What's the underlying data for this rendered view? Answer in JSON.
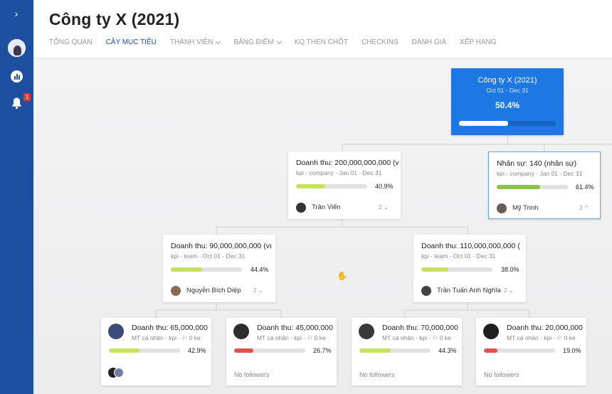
{
  "app": {
    "title": "Công ty X (2021)",
    "notification_count": "1",
    "accent_color": "#1e50a2",
    "root_color": "#1e78e3"
  },
  "sidebar": {
    "icons": [
      "expand-chevron-icon",
      "user-avatar",
      "chart-icon",
      "bell-icon"
    ]
  },
  "tabs": [
    {
      "label": "TỔNG QUAN",
      "active": false,
      "dropdown": false
    },
    {
      "label": "CÂY MỤC TIÊU",
      "active": true,
      "dropdown": false
    },
    {
      "label": "THÀNH VIÊN",
      "active": false,
      "dropdown": true
    },
    {
      "label": "BẢNG ĐIỂM",
      "active": false,
      "dropdown": true
    },
    {
      "label": "KQ THEN CHỐT",
      "active": false,
      "dropdown": false
    },
    {
      "label": "CHECKINS",
      "active": false,
      "dropdown": false
    },
    {
      "label": "ĐÁNH GIÁ",
      "active": false,
      "dropdown": false
    },
    {
      "label": "XẾP HẠNG",
      "active": false,
      "dropdown": false
    }
  ],
  "tree": {
    "root": {
      "title": "Công ty X (2021)",
      "date": "Oct 01 - Dec 31",
      "progress_label": "50.4%",
      "progress": 0.504
    },
    "level1": [
      {
        "title": "Doanh thu: 200,000,000,000 (v",
        "meta": "kpi · company · Jan 01 - Dec 31",
        "progress_label": "40.9%",
        "progress": 0.409,
        "bar_color": "#c5e25a",
        "owner": "Trần Viển",
        "count": "2"
      },
      {
        "title": "Nhân sự: 140 (nhân sự)",
        "meta": "kpi · company · Jan 01 - Dec 31",
        "progress_label": "61.4%",
        "progress": 0.614,
        "bar_color": "#8bc34a",
        "owner": "Mỹ Trinh",
        "count": "2"
      }
    ],
    "level2": [
      {
        "title": "Doanh thu: 90,000,000,000 (vı",
        "meta": "kpi · team · Oct 01 - Dec 31",
        "progress_label": "44.4%",
        "progress": 0.444,
        "bar_color": "#c5e25a",
        "owner": "Nguyễn Bích Diệp",
        "count": "2"
      },
      {
        "title": "Doanh thu: 110,000,000,000 (",
        "meta": "kpi · team · Oct 01 - Dec 31",
        "progress_label": "38.0%",
        "progress": 0.38,
        "bar_color": "#c5e25a",
        "owner": "Trần Tuấn Anh Nghĩa",
        "count": "2"
      }
    ],
    "level3": [
      {
        "title": "Doanh thu: 65,000,000",
        "meta": "MT cá nhân · kpi · ⚐ 0 ke",
        "progress_label": "42.9%",
        "progress": 0.429,
        "bar_color": "#c5e25a",
        "followers": ""
      },
      {
        "title": "Doanh thu: 45,000,000",
        "meta": "MT cá nhân · kpi · ⚐ 0 ke",
        "progress_label": "26.7%",
        "progress": 0.267,
        "bar_color": "#e0524b",
        "followers": "No followers"
      },
      {
        "title": "Doanh thu: 70,000,000",
        "meta": "MT cá nhân · kpi · ⚐ 0 ke",
        "progress_label": "44.3%",
        "progress": 0.443,
        "bar_color": "#c5e25a",
        "followers": "No followers"
      },
      {
        "title": "Doanh thu: 20,000,000",
        "meta": "MT cá nhân · kpi · ⚐ 0 ke",
        "progress_label": "19.0%",
        "progress": 0.19,
        "bar_color": "#e0524b",
        "followers": "No followers"
      }
    ]
  }
}
